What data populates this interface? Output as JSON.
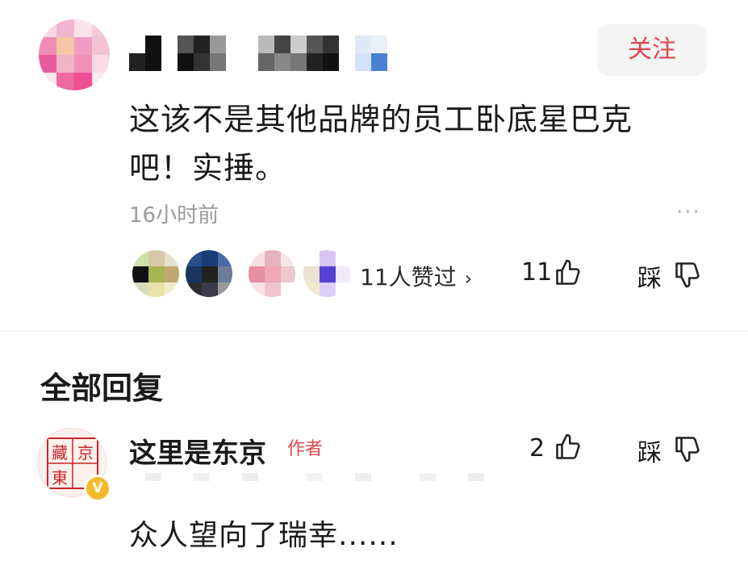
{
  "comment": {
    "follow_label": "关注",
    "text_line1": "这该不是其他品牌的员工卧底星巴克",
    "text_line2": "吧！实捶。",
    "time": "16小时前",
    "more": "···",
    "likers_text": "11人赞过",
    "likers_chevron": "›",
    "like_count": "11",
    "dislike_label": "踩"
  },
  "replies_section": {
    "title": "全部回复"
  },
  "reply": {
    "author_name": "这里是东京",
    "author_tag": "作者",
    "like_count": "2",
    "dislike_label": "踩",
    "text": "众人望向了瑞幸......",
    "avatar_chars": [
      "藏",
      "京",
      "東"
    ],
    "verified_badge": "V"
  },
  "colors": {
    "accent_red": "#e0464c",
    "gray_text": "#9a9a9a",
    "verify_gold": "#f6b929"
  },
  "icons": {
    "like": "thumbs-up-icon",
    "dislike": "thumbs-down-icon",
    "more": "more-dots-icon",
    "chevron": "chevron-right-icon"
  }
}
